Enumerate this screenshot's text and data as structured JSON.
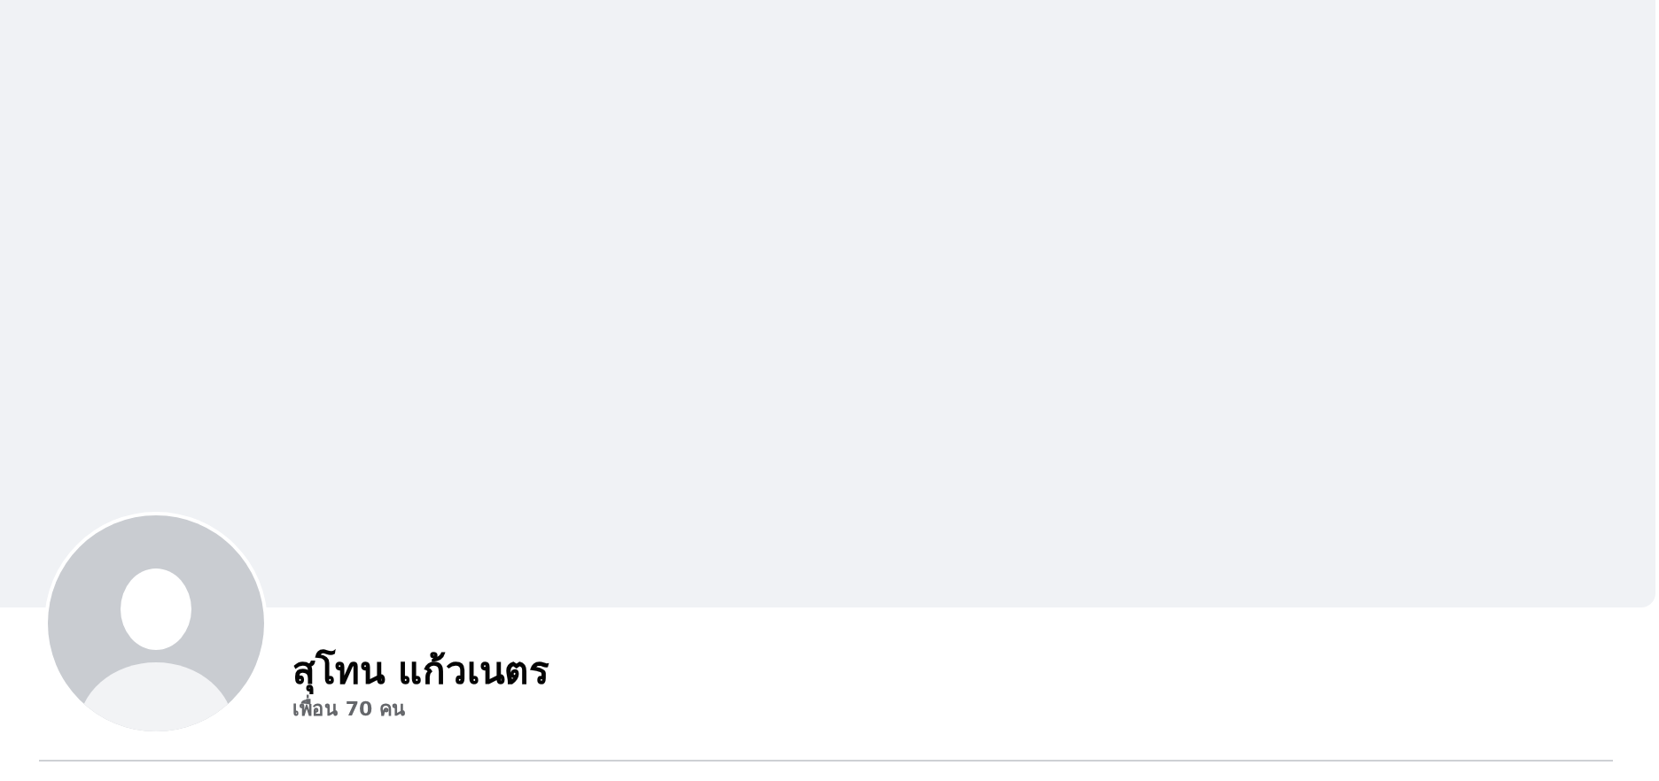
{
  "profile": {
    "name": "สุโทน แก้วเนตร",
    "friends": "เพื่อน 70 คน"
  }
}
